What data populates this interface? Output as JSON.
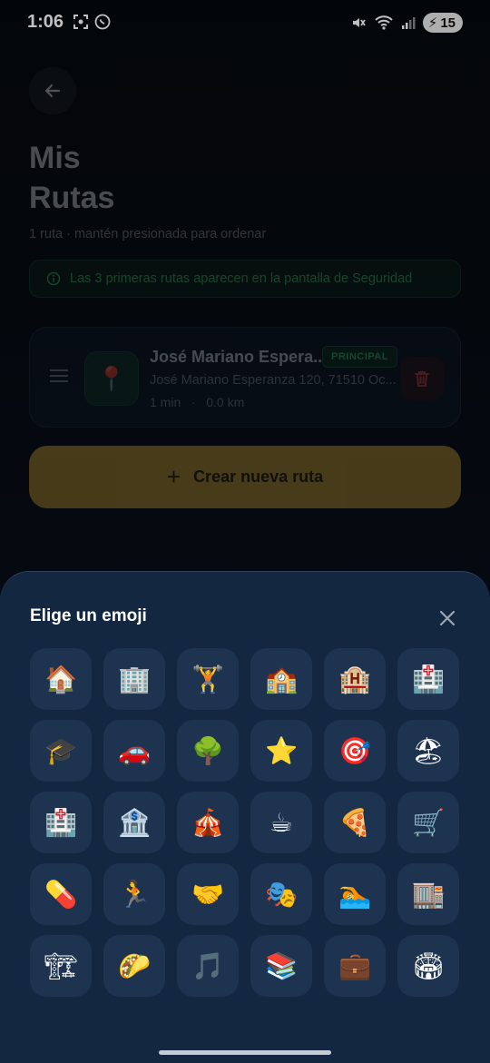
{
  "status_bar": {
    "time": "1:06",
    "battery": "15"
  },
  "page": {
    "title_line1": "Mis",
    "title_line2": "Rutas",
    "subtitle": "1 ruta · mantén presionada para ordenar",
    "info_banner": "Las 3 primeras rutas aparecen en la pantalla de Seguridad",
    "route": {
      "name": "José Mariano Espera...",
      "badge": "PRINCIPAL",
      "address": "José Mariano Esperanza 120, 71510 Oc...",
      "duration": "1 min",
      "separator": "·",
      "distance": "0.0 km",
      "icon": "📍"
    },
    "create_button": {
      "plus": "+",
      "label": "Crear nueva ruta"
    }
  },
  "emoji_sheet": {
    "title": "Elige un emoji",
    "close_icon": "×",
    "emojis": [
      "🏠",
      "🏢",
      "🏋",
      "🏫",
      "🏨",
      "🏥",
      "🎓",
      "🚗",
      "🌳",
      "⭐",
      "🎯",
      "🏖",
      "🏥",
      "🏦",
      "🎪",
      "☕",
      "🍕",
      "🛒",
      "💊",
      "🏃",
      "🤝",
      "🎭",
      "🏊",
      "🏬",
      "🏗",
      "🌮",
      "🎵",
      "📚",
      "💼",
      "🏟"
    ]
  },
  "colors": {
    "accent_gold": "#caa034",
    "sheet_bg": "#132740",
    "cell_bg": "#1d3350",
    "success_green": "#3fbf6f"
  }
}
